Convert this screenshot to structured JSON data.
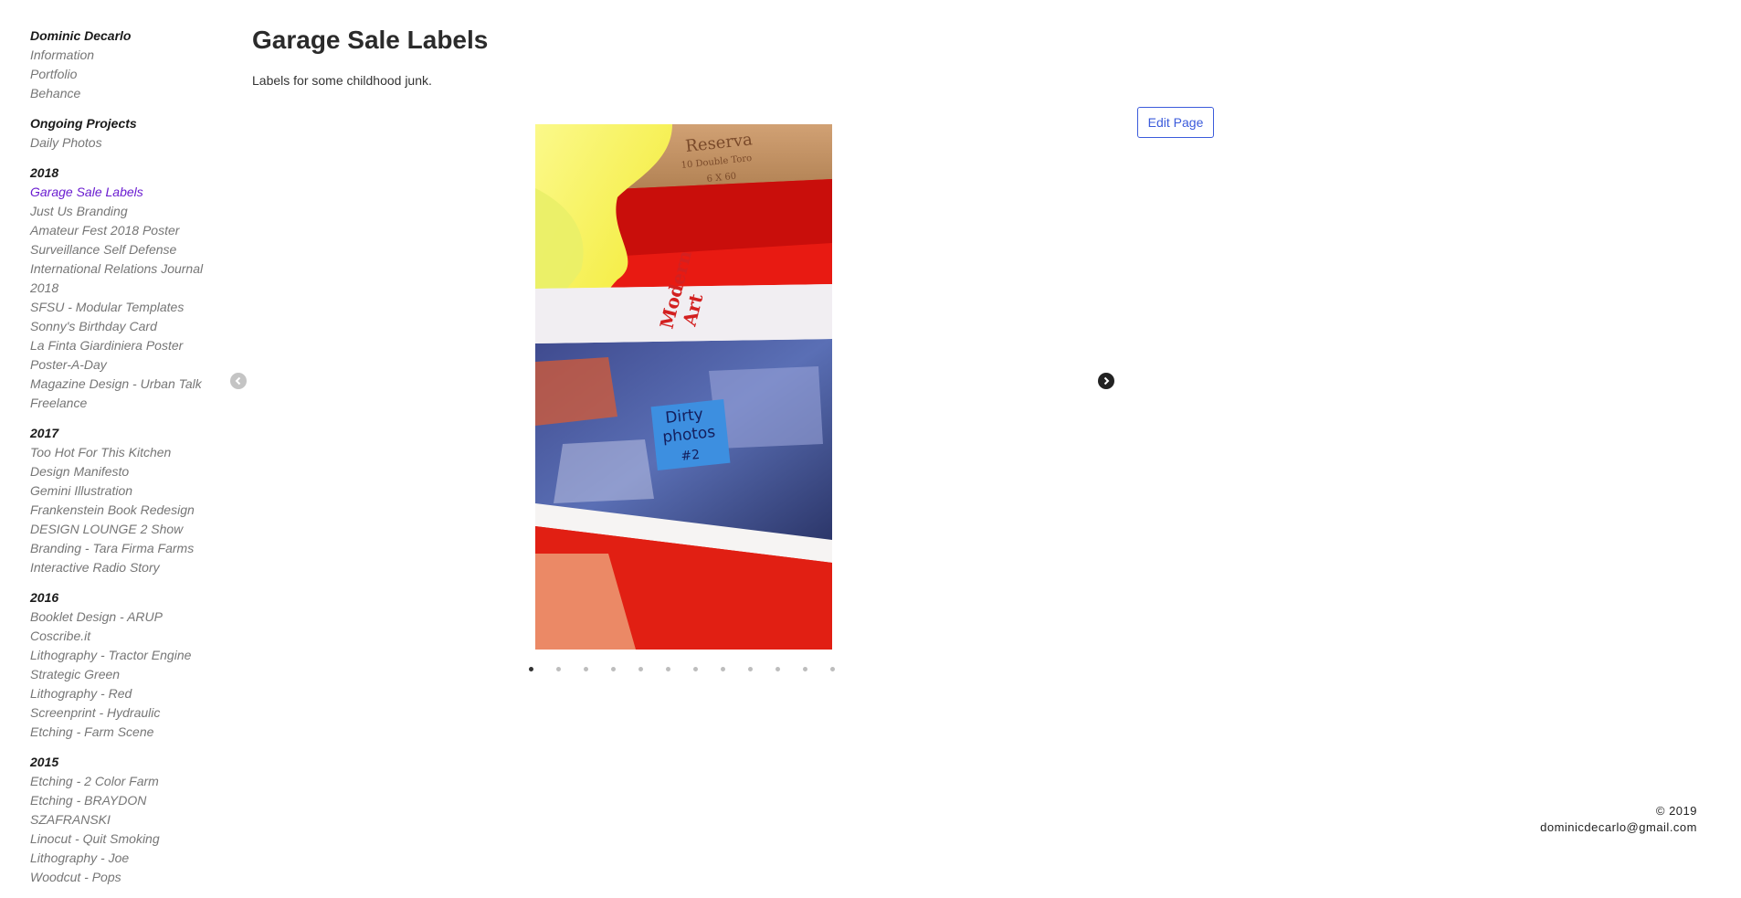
{
  "sidebar": {
    "owner": "Dominic Decarlo",
    "owner_links": [
      "Information",
      "Portfolio",
      "Behance"
    ],
    "groups": [
      {
        "heading": "Ongoing Projects",
        "items": [
          "Daily Photos"
        ]
      },
      {
        "heading": "2018",
        "items": [
          "Garage Sale Labels",
          "Just Us Branding",
          "Amateur Fest 2018 Poster",
          "Surveillance Self Defense",
          "International Relations Journal 2018",
          "SFSU - Modular Templates",
          "Sonny's Birthday Card",
          "La Finta Giardiniera Poster",
          "Poster-A-Day",
          "Magazine Design - Urban Talk",
          "Freelance"
        ]
      },
      {
        "heading": "2017",
        "items": [
          "Too Hot For This Kitchen",
          "Design Manifesto",
          "Gemini Illustration",
          "Frankenstein Book Redesign",
          "DESIGN LOUNGE 2 Show",
          "Branding - Tara Firma Farms",
          "Interactive Radio Story"
        ]
      },
      {
        "heading": "2016",
        "items": [
          "Booklet Design - ARUP",
          "Coscribe.it",
          "Lithography - Tractor Engine",
          "Strategic Green",
          "Lithography - Red",
          "Screenprint - Hydraulic",
          "Etching - Farm Scene"
        ]
      },
      {
        "heading": "2015",
        "items": [
          "Etching - 2 Color Farm",
          "Etching - BRAYDON SZAFRANSKI",
          "Linocut - Quit Smoking",
          "Lithography - Joe",
          "Woodcut - Pops"
        ]
      }
    ],
    "active_item": "Garage Sale Labels"
  },
  "page": {
    "title": "Garage Sale Labels",
    "description": "Labels for some childhood junk.",
    "edit_label": "Edit Page"
  },
  "slideshow": {
    "slide_count": 12,
    "active_index": 0,
    "photo": {
      "box_stamp": [
        "Reserva",
        "10 Double Toro",
        "6 X 60"
      ],
      "book_label": [
        "Modern",
        "Art"
      ],
      "sticky_note": [
        "Dirty",
        "photos",
        "#2"
      ]
    },
    "prev_icon": "chevron-left-circle-icon",
    "next_icon": "chevron-right-circle-icon"
  },
  "footer": {
    "copyright": "© 2019",
    "email": "dominicdecarlo@gmail.com"
  },
  "colors": {
    "active_link": "#6a1cd0",
    "muted_link": "#767676",
    "edit_accent": "#3b5bdb"
  }
}
